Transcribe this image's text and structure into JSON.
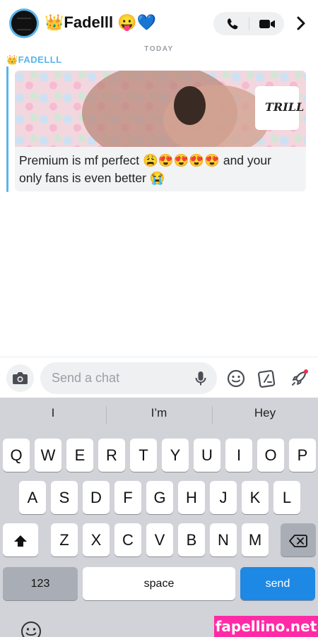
{
  "header": {
    "title": "👑Fadelll 😛💙",
    "icons": {
      "phone": "phone-icon",
      "video": "video-icon",
      "chevron": "chevron-right-icon"
    }
  },
  "chat": {
    "date_label": "TODAY",
    "sender": "👑FADELLL",
    "media_watermark": "TRILL",
    "message_line1": "Premium is mf perfect 😩😍😍😍😍 and your",
    "message_line2": "only fans is even better 😭"
  },
  "input": {
    "placeholder": "Send a chat",
    "value": ""
  },
  "keyboard": {
    "suggestions": [
      "I",
      "I’m",
      "Hey"
    ],
    "row1": [
      "Q",
      "W",
      "E",
      "R",
      "T",
      "Y",
      "U",
      "I",
      "O",
      "P"
    ],
    "row2": [
      "A",
      "S",
      "D",
      "F",
      "G",
      "H",
      "J",
      "K",
      "L"
    ],
    "row3": [
      "Z",
      "X",
      "C",
      "V",
      "B",
      "N",
      "M"
    ],
    "numbers_label": "123",
    "space_label": "space",
    "send_label": "send"
  },
  "watermark": "fapellino.net",
  "colors": {
    "accent": "#5ab4ea",
    "send": "#1e88e5",
    "watermark": "#ff2aa6"
  }
}
